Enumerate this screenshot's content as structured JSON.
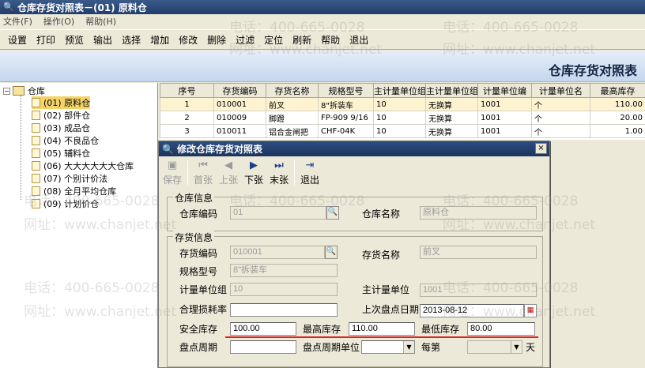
{
  "window": {
    "title": "仓库存货对照表－(01) 原料仓"
  },
  "menu": [
    "文件(F)",
    "操作(O)",
    "帮助(H)"
  ],
  "toolbar": [
    "设置",
    "打印",
    "预览",
    "输出",
    "选择",
    "增加",
    "修改",
    "删除",
    "过滤",
    "定位",
    "刷新",
    "帮助",
    "退出"
  ],
  "header": {
    "title": "仓库存货对照表"
  },
  "tree": {
    "root": "仓库",
    "items": [
      "(01) 原料仓",
      "(02) 部件仓",
      "(03) 成品仓",
      "(04) 不良品仓",
      "(05) 辅料仓",
      "(06) 大大大大大大仓库",
      "(07) 个别计价法",
      "(08) 全月平均仓库",
      "(09) 计划价仓"
    ]
  },
  "grid": {
    "columns": [
      "序号",
      "存货编码",
      "存货名称",
      "规格型号",
      "主计量单位组编",
      "主计量单位组名",
      "计量单位编",
      "计量单位名",
      "最高库存"
    ],
    "rows": [
      [
        "1",
        "010001",
        "前叉",
        "8\"拆装车",
        "10",
        "无换算",
        "1001",
        "个",
        "110.00"
      ],
      [
        "2",
        "010009",
        "脚蹬",
        "FP-909 9/16",
        "10",
        "无换算",
        "1001",
        "个",
        "20.00"
      ],
      [
        "3",
        "010011",
        "铝合金闸把",
        "CHF-04K",
        "10",
        "无换算",
        "1001",
        "个",
        "1.00"
      ]
    ]
  },
  "dialog": {
    "title": "修改仓库存货对照表",
    "close": "×",
    "buttons": {
      "save": "保存",
      "first": "首张",
      "prev": "上张",
      "next": "下张",
      "last": "末张",
      "exit": "退出"
    },
    "warehouse_group": "仓库信息",
    "warehouse_code_label": "仓库编码",
    "warehouse_code": "01",
    "warehouse_name_label": "仓库名称",
    "warehouse_name": "原料仓",
    "inventory_group": "存货信息",
    "inv_code_label": "存货编码",
    "inv_code": "010001",
    "inv_name_label": "存货名称",
    "inv_name": "前叉",
    "spec_label": "规格型号",
    "spec": "8\"拆装车",
    "unit_group_label": "计量单位组",
    "unit_group": "10",
    "main_unit_label": "主计量单位",
    "main_unit": "1001",
    "loss_rate_label": "合理损耗率",
    "loss_rate": "",
    "last_check_label": "上次盘点日期",
    "last_check": "2013-08-12",
    "safety_label": "安全库存",
    "safety": "100.00",
    "max_label": "最高库存",
    "max": "110.00",
    "min_label": "最低库存",
    "min": "80.00",
    "check_cycle_label": "盘点周期",
    "check_cycle": "",
    "cycle_unit_label": "盘点周期单位",
    "cycle_unit": "",
    "every_label": "每第",
    "every": "",
    "day_label": "天"
  },
  "watermark": {
    "phone": "电话：400-665-0028",
    "site": "网址：www.chanjet.net"
  }
}
